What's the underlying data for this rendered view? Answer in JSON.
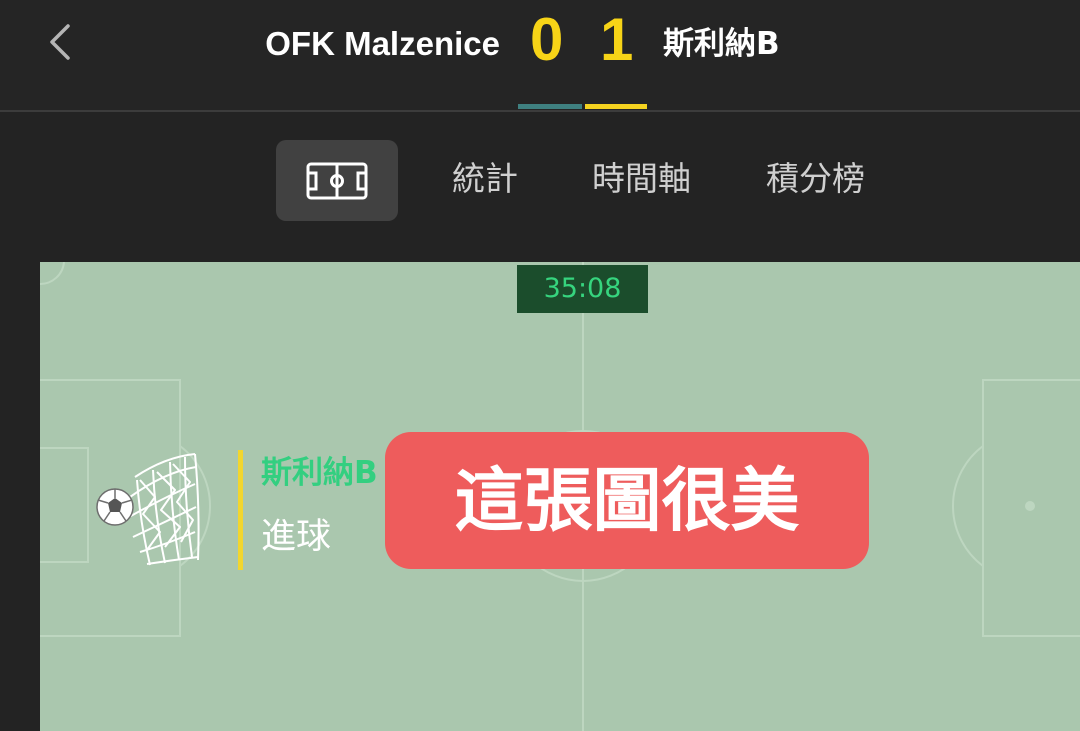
{
  "header": {
    "home_team": "OFK Malzenice",
    "away_team": "斯利納B",
    "home_score": "0",
    "away_score": "1",
    "home_color": "#3f8080",
    "away_color": "#f5d320",
    "score_color": "#f7d417"
  },
  "tabs": {
    "pitch_icon": "pitch-icon",
    "stats": "統計",
    "timeline": "時間軸",
    "standings": "積分榜"
  },
  "pitch": {
    "clock": "35:08",
    "event": {
      "team": "斯利納B",
      "type": "進球",
      "icon": "goal-net-icon"
    }
  },
  "overlay": {
    "text": "這張圖很美"
  }
}
